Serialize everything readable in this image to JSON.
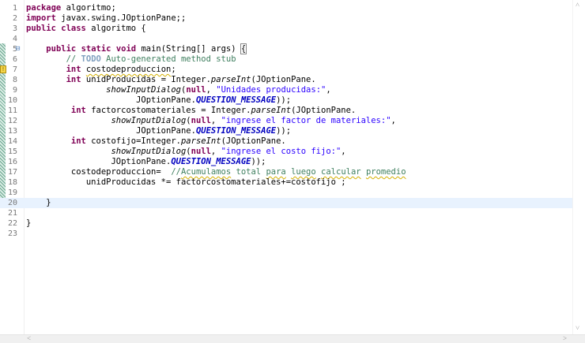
{
  "editor": {
    "lines": [
      {
        "num": "1",
        "html": "<span class=\"kw\">package</span> algoritmo;"
      },
      {
        "num": "2",
        "html": "<span class=\"kw\">import</span> javax.swing.JOptionPane;;"
      },
      {
        "num": "3",
        "html": "<span class=\"kw\">public</span> <span class=\"kw\">class</span> algoritmo {"
      },
      {
        "num": "4",
        "html": ""
      },
      {
        "num": "5",
        "html": "    <span class=\"kw\">public</span> <span class=\"kw\">static</span> <span class=\"kw\">void</span> main(String[] args) <span class=\"bracket\">{</span>"
      },
      {
        "num": "6",
        "html": "        <span class=\"cm\">// <span class=\"todo\">TODO</span> Auto-generated method stub</span>"
      },
      {
        "num": "7",
        "html": "        <span class=\"kw\">int</span> <span class=\"squig\">costodeproduccion</span>;"
      },
      {
        "num": "8",
        "html": "        <span class=\"kw\">int</span> unidProducidas = Integer.<span class=\"it\">parseInt</span>(JOptionPane."
      },
      {
        "num": "9",
        "html": "                <span class=\"it\">showInputDialog</span>(<span class=\"kw\">null</span>, <span class=\"str\">\"Unidades producidas:\"</span>,"
      },
      {
        "num": "10",
        "html": "                      JOptionPane.<span class=\"const\">QUESTION_MESSAGE</span>));"
      },
      {
        "num": "11",
        "html": "         <span class=\"kw\">int</span> factorcostomateriales = Integer.<span class=\"it\">parseInt</span>(JOptionPane."
      },
      {
        "num": "12",
        "html": "                 <span class=\"it\">showInputDialog</span>(<span class=\"kw\">null</span>, <span class=\"str\">\"ingrese el factor de materiales:\"</span>,"
      },
      {
        "num": "13",
        "html": "                      JOptionPane.<span class=\"const\">QUESTION_MESSAGE</span>));"
      },
      {
        "num": "14",
        "html": "         <span class=\"kw\">int</span> costofijo=Integer.<span class=\"it\">parseInt</span>(JOptionPane."
      },
      {
        "num": "15",
        "html": "                 <span class=\"it\">showInputDialog</span>(<span class=\"kw\">null</span>, <span class=\"str\">\"ingrese el costo fijo:\"</span>,"
      },
      {
        "num": "16",
        "html": "                 JOptionPane.<span class=\"const\">QUESTION_MESSAGE</span>));"
      },
      {
        "num": "17",
        "html": "         costodeproduccion=  <span class=\"cm\">//<span class=\"squig\">Acumulamos</span> total <span class=\"squig\">para</span> <span class=\"squig\">luego</span> <span class=\"squig\">calcular</span> <span class=\"squig\">promedio</span></span>"
      },
      {
        "num": "18",
        "html": "            unidProducidas *= factorcostomateriales+=costofijo ;"
      },
      {
        "num": "19",
        "html": ""
      },
      {
        "num": "20",
        "html": "    }"
      },
      {
        "num": "21",
        "html": ""
      },
      {
        "num": "22",
        "html": "}"
      },
      {
        "num": "23",
        "html": ""
      }
    ],
    "current_line": "20"
  }
}
